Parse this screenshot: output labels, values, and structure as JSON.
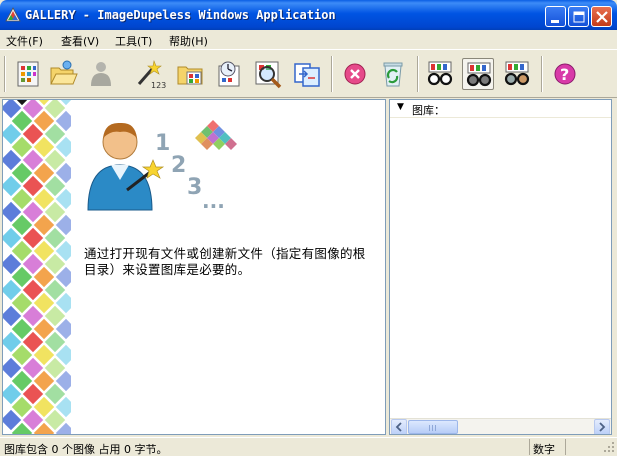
{
  "window": {
    "title": "GALLERY - ImageDupeless Windows Application",
    "controls": [
      "minimize",
      "maximize",
      "close"
    ]
  },
  "menu": {
    "items": [
      {
        "label": "文件(F)"
      },
      {
        "label": "查看(V)"
      },
      {
        "label": "工具(T)"
      },
      {
        "label": "帮助(H)"
      }
    ]
  },
  "toolbar": {
    "icons": [
      "gallery-icon",
      "open-folder-icon",
      "disabled-user-icon",
      "wizard-icon",
      "browse-folder-icon",
      "clock-scan-icon",
      "search-image-icon",
      "compare-icon",
      "stop-icon",
      "recycle-icon",
      "glasses-icon",
      "glasses-dark-icon",
      "glasses-gray-icon",
      "help-icon"
    ]
  },
  "left_pane": {
    "hero_numbers": [
      "1",
      "2",
      "3",
      "..."
    ],
    "hint": "通过打开现有文件或创建新文件（指定有图像的根目录）来设置图库是必要的。"
  },
  "right_pane": {
    "tree_label": "图库："
  },
  "status": {
    "text": "图库包含 0 个图像 占用 0 字节。",
    "mode": "数字"
  },
  "colors": {
    "title_bar": "#0054e3",
    "window_bg": "#ece9d8",
    "pane_border": "#7f9db9"
  }
}
